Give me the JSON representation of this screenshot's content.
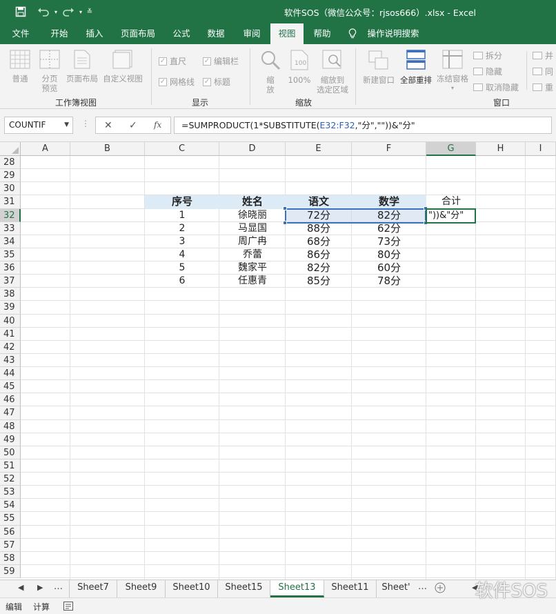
{
  "window": {
    "title": "软件SOS（微信公众号：rjsos666）.xlsx  -  Excel"
  },
  "ribbon_tabs": [
    {
      "label": "文件"
    },
    {
      "label": "开始"
    },
    {
      "label": "插入"
    },
    {
      "label": "页面布局"
    },
    {
      "label": "公式"
    },
    {
      "label": "数据"
    },
    {
      "label": "审阅"
    },
    {
      "label": "视图"
    },
    {
      "label": "帮助"
    },
    {
      "label": "操作说明搜索"
    }
  ],
  "active_tab": "视图",
  "ribbon": {
    "workbook_views": {
      "label": "工作簿视图",
      "normal": "普通",
      "page_break_line1": "分页",
      "page_break_line2": "预览",
      "page_layout": "页面布局",
      "custom_views": "自定义视图"
    },
    "show": {
      "label": "显示",
      "ruler": "直尺",
      "formula_bar": "编辑栏",
      "gridlines": "网格线",
      "headings": "标题"
    },
    "zoom": {
      "label": "缩放",
      "zoom_line1": "缩",
      "zoom_line2": "放",
      "zoom100": "100%",
      "zoom_sel_line1": "缩放到",
      "zoom_sel_line2": "选定区域"
    },
    "window": {
      "label": "窗口",
      "new_window": "新建窗口",
      "arrange_all": "全部重排",
      "freeze_panes": "冻结窗格",
      "split": "拆分",
      "hide": "隐藏",
      "unhide": "取消隐藏",
      "side_by_side": "并",
      "sync_scroll": "同",
      "reset": "重"
    }
  },
  "formula_bar": {
    "name_box": "COUNTIF",
    "formula_prefix": "=SUMPRODUCT(1*SUBSTITUTE(",
    "formula_ref": "E32:F32",
    "formula_suffix": ",\"分\",\"\"))&\"分\""
  },
  "columns": [
    "A",
    "B",
    "C",
    "D",
    "E",
    "F",
    "G",
    "H",
    "I"
  ],
  "rows": [
    "28",
    "29",
    "30",
    "31",
    "32",
    "33",
    "34",
    "35",
    "36",
    "37",
    "38",
    "39",
    "40",
    "41",
    "42",
    "43",
    "44",
    "45",
    "46",
    "47",
    "48",
    "49",
    "50",
    "51",
    "52",
    "53",
    "54",
    "55",
    "56",
    "57",
    "58",
    "59"
  ],
  "table": {
    "headers": [
      "序号",
      "姓名",
      "语文",
      "数学",
      "合计"
    ],
    "rows": [
      [
        "1",
        "徐晓丽",
        "72分",
        "82分"
      ],
      [
        "2",
        "马显国",
        "88分",
        "62分"
      ],
      [
        "3",
        "周广冉",
        "68分",
        "73分"
      ],
      [
        "4",
        "乔蕾",
        "86分",
        "80分"
      ],
      [
        "5",
        "魏家平",
        "82分",
        "60分"
      ],
      [
        "6",
        "任惠青",
        "85分",
        "78分"
      ]
    ],
    "active_cell_text": "\"))&\"分\""
  },
  "sheet_tabs": [
    "Sheet7",
    "Sheet9",
    "Sheet10",
    "Sheet15",
    "Sheet13",
    "Sheet11",
    "Sheet'"
  ],
  "active_sheet": "Sheet13",
  "status": {
    "mode": "编辑",
    "calc": "计算"
  },
  "watermark": "软件SOS",
  "colors": {
    "excel_green": "#217346",
    "header_band": "#ddebf7",
    "selection_border": "#3c6fbe"
  }
}
